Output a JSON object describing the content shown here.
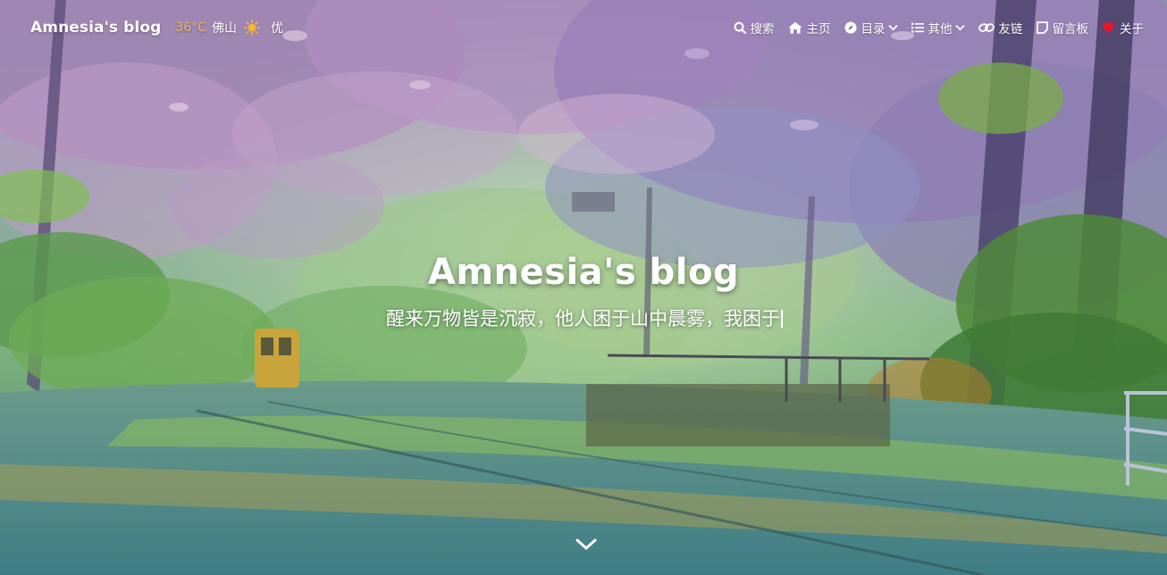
{
  "site": {
    "name": "Amnesia's blog"
  },
  "weather": {
    "temperature": "36°C",
    "city": "佛山",
    "condition_icon": "sun-icon",
    "air_quality": "优"
  },
  "nav": {
    "items": [
      {
        "label": "搜索",
        "icon": "search-icon"
      },
      {
        "label": "主页",
        "icon": "home-icon"
      },
      {
        "label": "目录",
        "icon": "compass-icon",
        "dropdown": true
      },
      {
        "label": "其他",
        "icon": "list-icon",
        "dropdown": true
      },
      {
        "label": "友链",
        "icon": "link-icon"
      },
      {
        "label": "留言板",
        "icon": "note-icon"
      },
      {
        "label": "关于",
        "icon": "heart-icon"
      }
    ]
  },
  "hero": {
    "title": "Amnesia's blog",
    "subtitle": "醒来万物皆是沉寂，他人困于山中晨雾，我困于"
  },
  "colors": {
    "temperature": "#f2b65a",
    "heart": "#e8162d",
    "text": "#ffffff"
  }
}
